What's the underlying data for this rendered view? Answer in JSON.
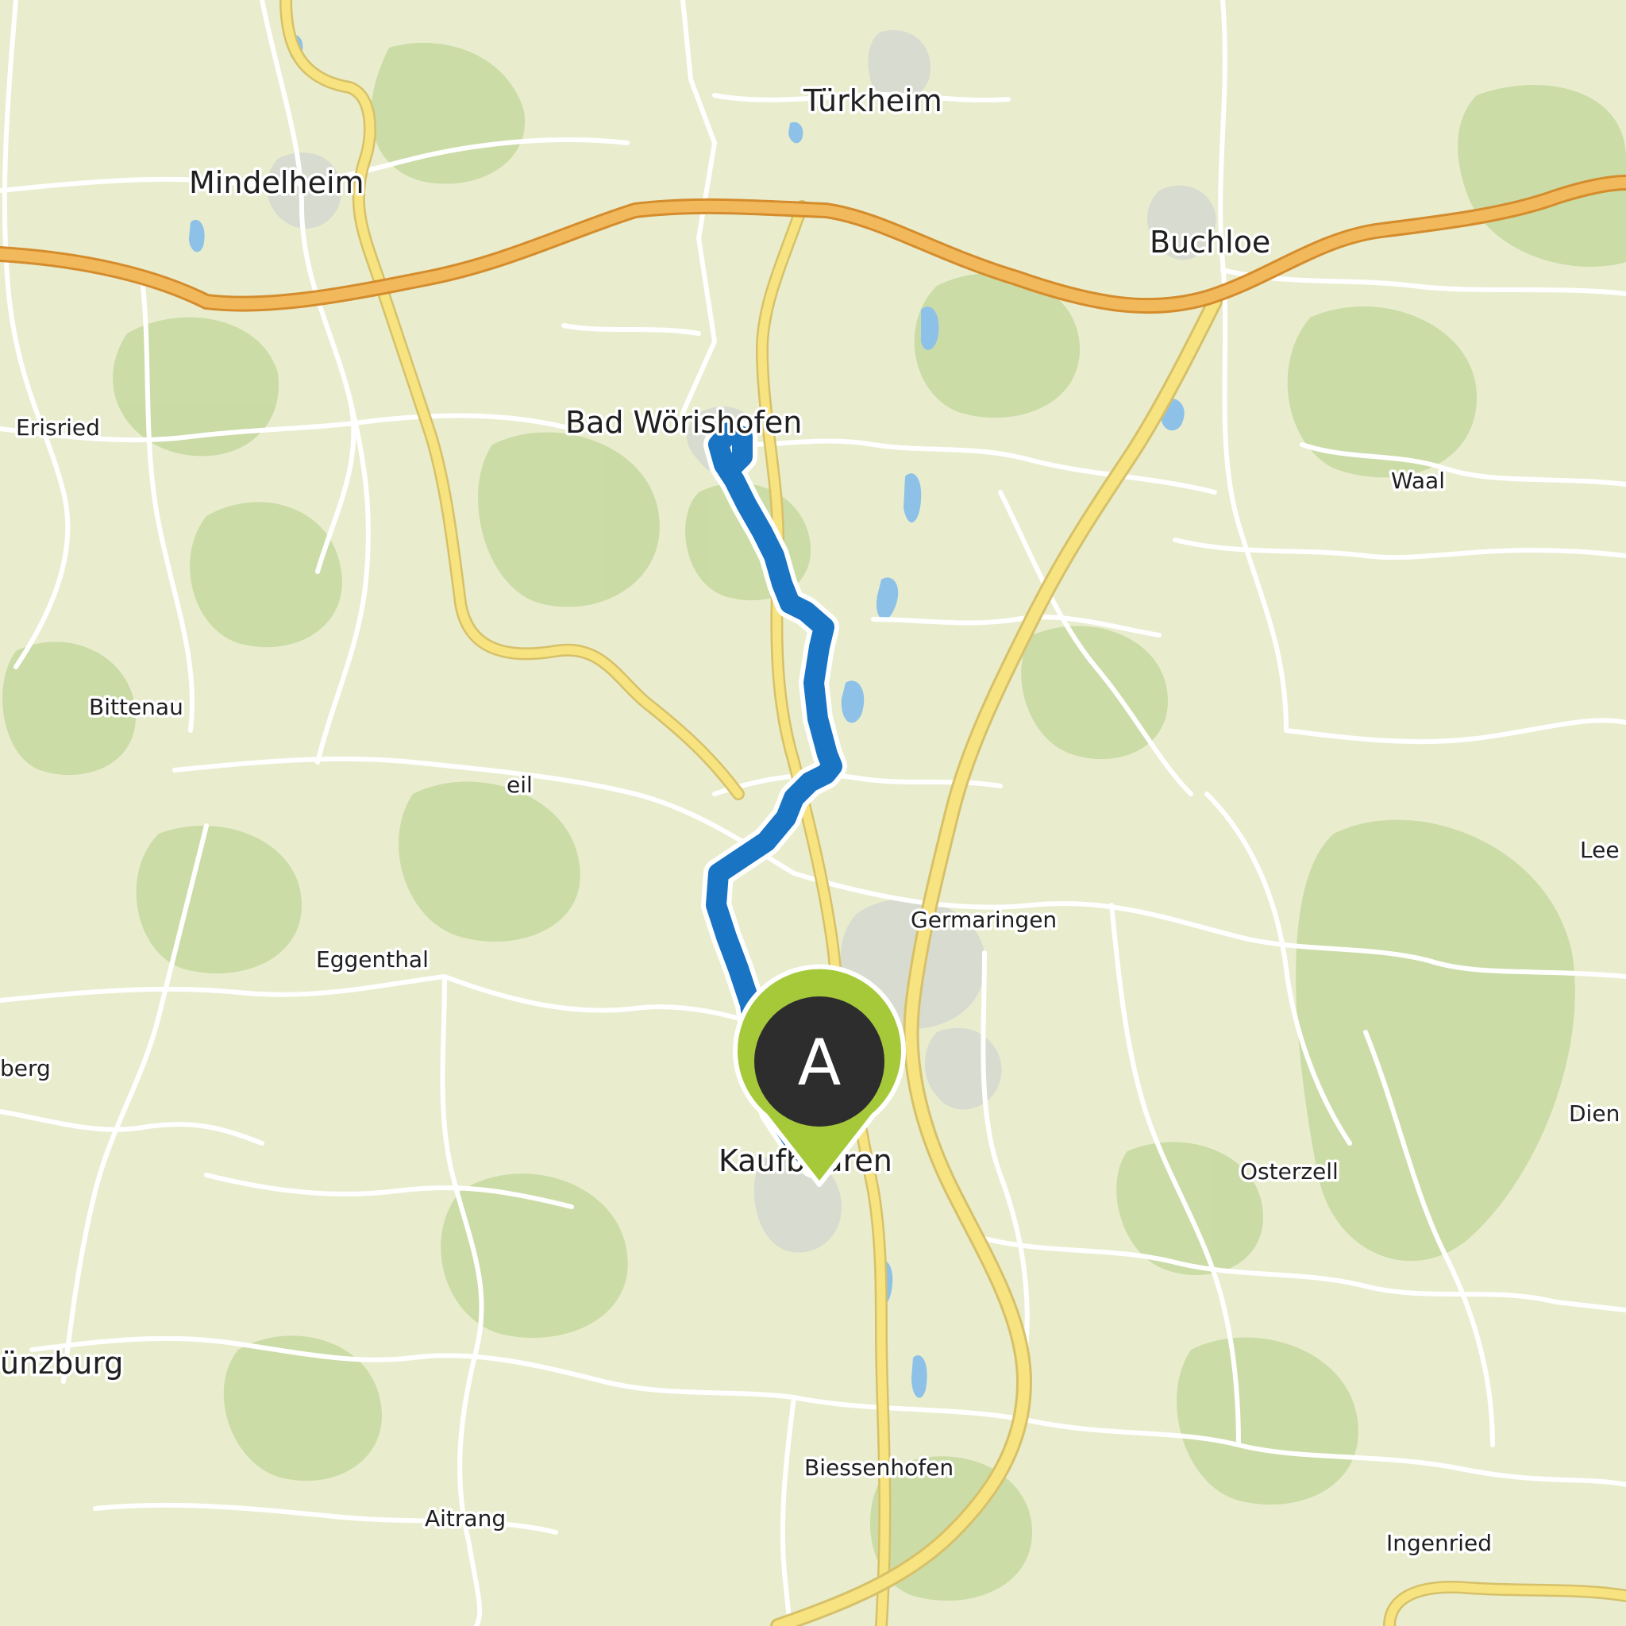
{
  "map": {
    "places": [
      {
        "name": "Türkheim",
        "type": "major"
      },
      {
        "name": "Mindelheim",
        "type": "major"
      },
      {
        "name": "Buchloe",
        "type": "major"
      },
      {
        "name": "Bad Wörishofen",
        "type": "major"
      },
      {
        "name": "Erisried",
        "type": "minor"
      },
      {
        "name": "Waal",
        "type": "minor"
      },
      {
        "name": "Bittenau",
        "type": "minor"
      },
      {
        "name": "eil",
        "type": "minor"
      },
      {
        "name": "Lee",
        "type": "minor"
      },
      {
        "name": "Germaringen",
        "type": "minor"
      },
      {
        "name": "Eggenthal",
        "type": "minor"
      },
      {
        "name": "berg",
        "type": "minor"
      },
      {
        "name": "Dien",
        "type": "minor"
      },
      {
        "name": "Kaufbeuren",
        "type": "major"
      },
      {
        "name": "Osterzell",
        "type": "minor"
      },
      {
        "name": "ünzburg",
        "type": "major"
      },
      {
        "name": "Biessenhofen",
        "type": "minor"
      },
      {
        "name": "Aitrang",
        "type": "minor"
      },
      {
        "name": "Ingenried",
        "type": "minor"
      }
    ],
    "route": {
      "color": "#1a74c4",
      "start_marker": {
        "letter": "A",
        "fill": "#2d2d2d",
        "border": "#a6c93a"
      }
    },
    "colors": {
      "background": "#e9edce",
      "forest": "#c7d9a2",
      "road": "#ffffff",
      "highway": "#f2b95c",
      "main_road": "#f7e37f",
      "water": "#8dc1e8",
      "urban": "#d9dcd2"
    }
  }
}
